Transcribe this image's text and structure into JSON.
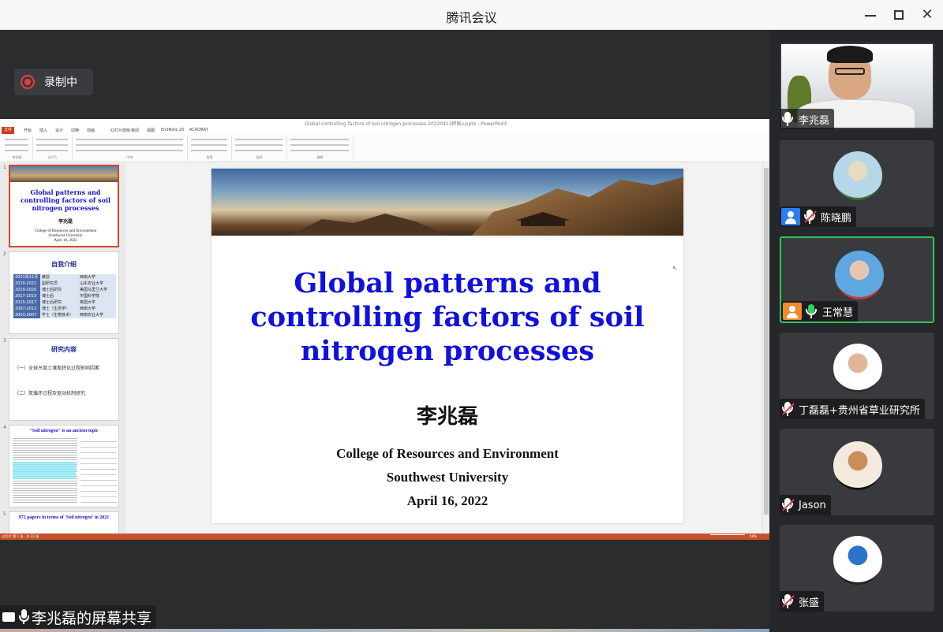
{
  "window": {
    "title": "腾讯会议",
    "minimize_label": "",
    "maximize_label": "",
    "close_label": "✕"
  },
  "recording": {
    "label": "录制中"
  },
  "share": {
    "label": "李兆磊的屏幕共享"
  },
  "powerpoint": {
    "window_title": "Global controlling factors of soil nitrogen processes-20220413终版v.pptx - PowerPoint",
    "tabs": [
      "文件",
      "开始",
      "插入",
      "设计",
      "切换",
      "动画",
      "幻灯片放映",
      "审阅",
      "视图",
      "EndNote 20",
      "ACROBAT"
    ],
    "ribbon_groups": [
      "剪贴板",
      "幻灯片",
      "字体",
      "段落",
      "绘图",
      "编辑"
    ],
    "status_left": "幻灯片 第 1 张，共 33 张",
    "status_right": "58%",
    "thumbnails": [
      {
        "num": "1",
        "title": "Global patterns and controlling factors of soil nitrogen processes",
        "author": "李兆磊",
        "lines": [
          "College of Resources and Environment",
          "Southwest University",
          "April 16, 2022"
        ]
      },
      {
        "num": "2",
        "title": "自我介绍",
        "rows": [
          [
            "2021年11月",
            "教授",
            "西南大学"
          ],
          [
            "2019-2021",
            "副研究员",
            "山东农业大学"
          ],
          [
            "2019-2020",
            "博士后研究",
            "美国马里兰大学"
          ],
          [
            "2017-2019",
            "博士后",
            "中国科学院"
          ],
          [
            "2015-2017",
            "博士后研究",
            "英国大学"
          ],
          [
            "2007-2013",
            "博士（生态学）",
            "西南大学"
          ],
          [
            "2003-2007",
            "学士（生物技术）",
            "西南农业大学"
          ]
        ]
      },
      {
        "num": "3",
        "title": "研究内容",
        "items": [
          "（一）全球尺度土壤氮转化过程影响因素",
          "（二）氮循环过程及驱动机制研究"
        ]
      },
      {
        "num": "4",
        "title": "\"Soil nitrogen\" is an ancient topic"
      },
      {
        "num": "5",
        "title": "972 papers in terms of 'Soil nitrogen' in 2021"
      }
    ],
    "slide": {
      "title": "Global patterns and controlling factors of soil nitrogen processes",
      "author": "李兆磊",
      "affiliation": "College of Resources and Environment",
      "university": "Southwest University",
      "date": "April 16, 2022"
    }
  },
  "participants": [
    {
      "name": "李兆磊",
      "video": true,
      "mic": "on-white",
      "speaking": false,
      "user_icon": false
    },
    {
      "name": "陈晓鹏",
      "video": false,
      "mic": "muted",
      "speaking": false,
      "user_icon": true,
      "user_icon_color": "#2b7cf6",
      "avatar_colors": [
        "#b6d7e8",
        "#e8dcc0",
        "#3a6b3a"
      ]
    },
    {
      "name": "王常慧",
      "video": false,
      "mic": "on",
      "speaking": true,
      "user_icon": true,
      "user_icon_color": "#f08a2a",
      "avatar_colors": [
        "#5ea7e0",
        "#e7c6b0",
        "#c53c3c"
      ]
    },
    {
      "name": "丁磊磊+贵州省草业研究所",
      "video": false,
      "mic": "muted",
      "speaking": false,
      "user_icon": false,
      "avatar_colors": [
        "#ffffff",
        "#e0b69a",
        "#2c2c2c"
      ]
    },
    {
      "name": "Jason",
      "video": false,
      "mic": "muted",
      "speaking": false,
      "user_icon": false,
      "avatar_colors": [
        "#f3e9dd",
        "#c98f5a",
        "#111111"
      ]
    },
    {
      "name": "张盛",
      "video": false,
      "mic": "muted",
      "speaking": false,
      "user_icon": false,
      "avatar_colors": [
        "#ffffff",
        "#2a74c9",
        "#222222"
      ]
    }
  ],
  "colors": {
    "accent_speaking": "#33c25a",
    "recording_red": "#e24040",
    "muted_red": "#e24040",
    "ppt_orange": "#c5522b",
    "slide_title_blue": "#1010e0"
  }
}
